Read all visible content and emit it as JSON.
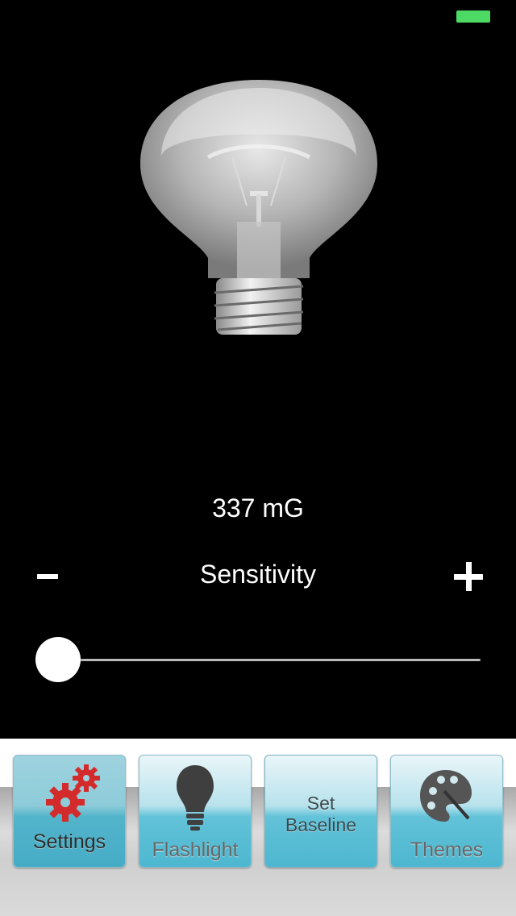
{
  "status_bar": {
    "battery_color": "#4cd964"
  },
  "main": {
    "bulb_icon": "light-bulb-icon",
    "reading": "337 mG",
    "sensitivity": {
      "label": "Sensitivity",
      "minus_label": "-",
      "plus_label": "+",
      "slider_value": 0
    }
  },
  "toolbar": {
    "settings": {
      "label": "Settings",
      "icon": "gears-icon"
    },
    "flashlight": {
      "label": "Flashlight",
      "icon": "bulb-icon"
    },
    "set_baseline": {
      "label_line1": "Set",
      "label_line2": "Baseline"
    },
    "themes": {
      "label": "Themes",
      "icon": "palette-icon"
    },
    "accent_color": "#4db7d0"
  }
}
